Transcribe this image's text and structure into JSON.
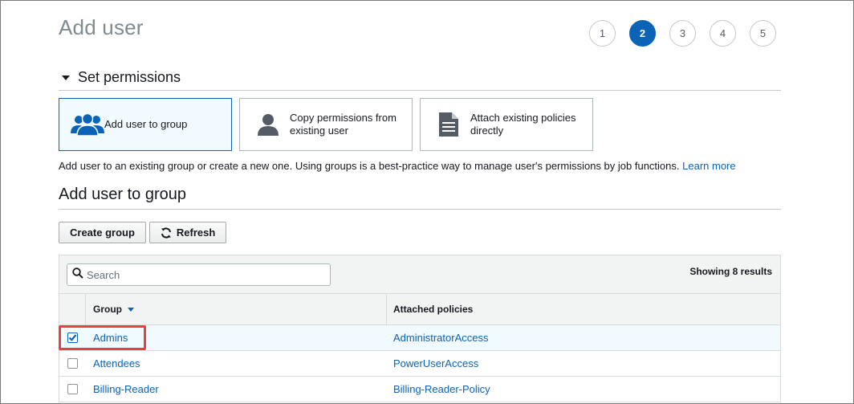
{
  "page": {
    "title": "Add user"
  },
  "steps": [
    {
      "label": "1",
      "active": false
    },
    {
      "label": "2",
      "active": true
    },
    {
      "label": "3",
      "active": false
    },
    {
      "label": "4",
      "active": false
    },
    {
      "label": "5",
      "active": false
    }
  ],
  "permissions": {
    "section_title": "Set permissions",
    "options": [
      {
        "label": "Add user to group",
        "icon": "users-group-icon",
        "selected": true
      },
      {
        "label": "Copy permissions from existing user",
        "icon": "user-icon",
        "selected": false
      },
      {
        "label": "Attach existing policies directly",
        "icon": "document-icon",
        "selected": false
      }
    ],
    "help_text": "Add user to an existing group or create a new one. Using groups is a best-practice way to manage user's permissions by job functions.",
    "learn_more": "Learn more"
  },
  "group_section": {
    "title": "Add user to group",
    "create_group_label": "Create group",
    "refresh_label": "Refresh"
  },
  "table": {
    "search_placeholder": "Search",
    "results": "Showing 8 results",
    "headers": {
      "group": "Group",
      "policies": "Attached policies"
    },
    "rows": [
      {
        "group": "Admins",
        "policy": "AdministratorAccess",
        "checked": true
      },
      {
        "group": "Attendees",
        "policy": "PowerUserAccess",
        "checked": false
      },
      {
        "group": "Billing-Reader",
        "policy": "Billing-Reader-Policy",
        "checked": false
      }
    ]
  },
  "colors": {
    "accent": "#0a63b6",
    "selected_bg": "#f1faff",
    "highlight": "#e8403f",
    "icon_gray": "#545b64"
  }
}
